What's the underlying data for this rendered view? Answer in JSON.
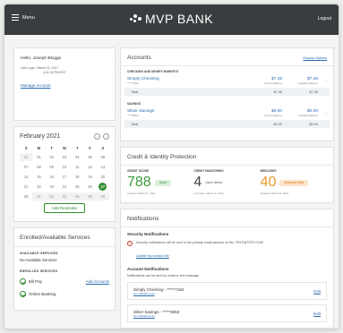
{
  "header": {
    "menu_label": "Menu",
    "brand": "MVP BANK",
    "logout": "Logout"
  },
  "user": {
    "greeting": "Hello, Joseph Bloggs",
    "last_login_line1": "Last Login: March 22, 2017",
    "last_login_line2": "4:41:32 PM EST",
    "manage_account": "Manage Account"
  },
  "calendar": {
    "title": "February 2021",
    "prev_icon": "chevron-left-icon",
    "next_icon": "chevron-right-icon",
    "weekdays": [
      "S",
      "M",
      "T",
      "W",
      "T",
      "F",
      "S"
    ],
    "days": [
      {
        "label": "31",
        "prev": true
      },
      {
        "label": "01"
      },
      {
        "label": "02"
      },
      {
        "label": "03"
      },
      {
        "label": "04"
      },
      {
        "label": "05"
      },
      {
        "label": "06"
      },
      {
        "label": "07"
      },
      {
        "label": "08"
      },
      {
        "label": "09"
      },
      {
        "label": "10"
      },
      {
        "label": "11"
      },
      {
        "label": "12"
      },
      {
        "label": "13"
      },
      {
        "label": "14"
      },
      {
        "label": "15"
      },
      {
        "label": "16"
      },
      {
        "label": "17"
      },
      {
        "label": "18"
      },
      {
        "label": "19"
      },
      {
        "label": "20"
      },
      {
        "label": "21"
      },
      {
        "label": "22"
      },
      {
        "label": "23"
      },
      {
        "label": "24"
      },
      {
        "label": "25"
      },
      {
        "label": "26"
      },
      {
        "label": "27",
        "today": true
      },
      {
        "label": "28"
      },
      {
        "label": "01",
        "prev": true
      },
      {
        "label": "02",
        "prev": true
      },
      {
        "label": "03",
        "prev": true
      },
      {
        "label": "04",
        "prev": true
      },
      {
        "label": "05",
        "prev": true
      },
      {
        "label": "06",
        "prev": true
      }
    ],
    "add_reminder": "Add Reminder"
  },
  "services": {
    "title": "Enrolled/Available Services",
    "available_label": "AVAILABLE SERVICES",
    "available_text": "No Available Services",
    "enrolled_label": "ENROLLED SERVICES",
    "enrolled": [
      "Bill Pay",
      "Online Banking"
    ],
    "add_accounts": "Add Accounts",
    "check_icon": "check-circle-icon"
  },
  "accounts": {
    "title": "Accounts",
    "display_options": "Display Options",
    "groups": [
      {
        "label": "CHECKING AND MONEY MARKETS",
        "accounts": [
          {
            "name": "Simply Checking",
            "number": "*****7184",
            "current": "$7.45",
            "current_label": "Current Balance",
            "available": "$7.45",
            "available_label": "Available Balance"
          }
        ],
        "total_label": "Total",
        "total_current": "$7.45",
        "total_available": "$7.45"
      },
      {
        "label": "SAVINGS",
        "accounts": [
          {
            "name": "Silver Savings",
            "number": "*****9063",
            "current": "$0.00",
            "current_label": "Current Balance",
            "available": "$0.00",
            "available_label": "Available Balance"
          }
        ],
        "total_label": "Total",
        "total_current": "$0.00",
        "total_available": "$0.00"
      }
    ]
  },
  "credit": {
    "title": "Credit & Identity Protection",
    "score_label": "CREDIT SCORE",
    "score": "788",
    "score_status": "Good",
    "score_date": "Updated: March 11, 2021",
    "monitoring_label": "CREDIT MONITORING",
    "monitoring_count": "4",
    "monitoring_text": "Open Alerts",
    "monitoring_date": "Last Scan: March 22, 2021",
    "breach_label": "BREACHES",
    "breach_value": "40",
    "breach_status": "Moderate Risk",
    "breach_date": "Updated: March 22, 2021"
  },
  "notifications": {
    "title": "Notifications",
    "security_title": "Security Notifications",
    "warning_icon": "alert-circle-icon",
    "security_text": "Security notifications will be sent to the primary email address on file, TEST@TEST.COM",
    "security_link": "Update my contact info",
    "account_title": "Account Notifications",
    "account_desc": "Notifications can be sent by email or text message.",
    "items": [
      {
        "name": "Simply Checking - *****7184",
        "sub": "No notifications set",
        "edit": "Edit"
      },
      {
        "name": "Silver Savings - *****9063",
        "sub": "No notifications set",
        "edit": "Edit"
      }
    ]
  }
}
